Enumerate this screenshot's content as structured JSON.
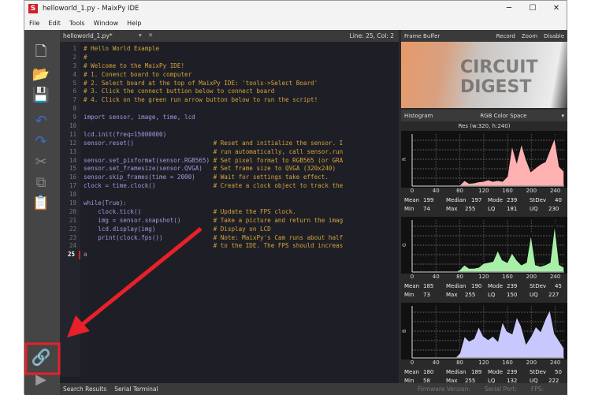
{
  "window": {
    "title": "helloworld_1.py - MaixPy IDE",
    "logo": "S",
    "minimize": "─",
    "maximize": "☐",
    "close": "✕"
  },
  "menu": [
    "File",
    "Edit",
    "Tools",
    "Window",
    "Help"
  ],
  "editor": {
    "tab": "helloworld_1.py*",
    "cursor": "Line: 25, Col: 2",
    "lines": [
      [
        "",
        "# Hello World Example"
      ],
      [
        "",
        "#"
      ],
      [
        "",
        "# Welcome to the MaixPy IDE!"
      ],
      [
        "",
        "# 1. Conenct board to computer"
      ],
      [
        "",
        "# 2. Select board at the top of MaixPy IDE: 'tools->Select Board'"
      ],
      [
        "",
        "# 3. Click the connect buttion below to connect board"
      ],
      [
        "",
        "# 4. Click on the green run arrow button below to run the script!"
      ],
      [
        "",
        ""
      ],
      [
        "import sensor, image, time, lcd",
        ""
      ],
      [
        "",
        ""
      ],
      [
        "lcd.init(freq=15000000)",
        ""
      ],
      [
        "sensor.reset()                      ",
        "# Reset and initialize the sensor. I"
      ],
      [
        "                                    ",
        "# run automatically, call sensor.run"
      ],
      [
        "sensor.set_pixformat(sensor.RGB565) ",
        "# Set pixel format to RGB565 (or GRA"
      ],
      [
        "sensor.set_framesize(sensor.QVGA)   ",
        "# Set frame size to QVGA (320x240)"
      ],
      [
        "sensor.skip_frames(time = 2000)     ",
        "# Wait for settings take effect."
      ],
      [
        "clock = time.clock()                ",
        "# Create a clock object to track the"
      ],
      [
        "",
        ""
      ],
      [
        "while(True):",
        ""
      ],
      [
        "    clock.tick()                    ",
        "# Update the FPS clock."
      ],
      [
        "    img = sensor.snapshot()         ",
        "# Take a picture and return the imag"
      ],
      [
        "    lcd.display(img)                ",
        "# Display on LCD"
      ],
      [
        "    print(clock.fps())              ",
        "# Note: MaixPy's Cam runs about half"
      ],
      [
        "                                    ",
        "# to the IDE. The FPS should increas"
      ],
      [
        "a",
        ""
      ]
    ]
  },
  "frame_buffer": {
    "title": "Frame Buffer",
    "record": "Record",
    "zoom": "Zoom",
    "disable": "Disable",
    "watermark": "CIRCUIT DIGEST"
  },
  "histogram": {
    "title": "Histogram",
    "color_space": "RGB Color Space",
    "res": "Res (w:320, h:240)",
    "ticks": [
      "0",
      "40",
      "80",
      "120",
      "160",
      "200",
      "240"
    ],
    "channels": [
      {
        "label": "R",
        "color": "#ffb0b0",
        "values": [
          0,
          0,
          0,
          0,
          0,
          0,
          0,
          0,
          0,
          0,
          0.02,
          0.12,
          0.06,
          0.07,
          0.09,
          0.1,
          0.13,
          0.1,
          0.12,
          0.1,
          0.2,
          0.85,
          0.5,
          0.88,
          0.55,
          0.3,
          0.38,
          0.45,
          0.5,
          0.75,
          1.0,
          0.4,
          0.3
        ],
        "stats": {
          "Mean": "199",
          "Median": "197",
          "Mode": "239",
          "StDev": "40",
          "Min": "74",
          "Max": "255",
          "LQ": "181",
          "UQ": "230"
        }
      },
      {
        "label": "G",
        "color": "#a8f0a8",
        "values": [
          0,
          0,
          0,
          0,
          0,
          0,
          0,
          0,
          0,
          0,
          0.05,
          0.15,
          0.08,
          0.08,
          0.1,
          0.18,
          0.2,
          0.22,
          0.45,
          0.25,
          0.2,
          0.4,
          0.25,
          0.15,
          0.2,
          0.8,
          0.15,
          0.12,
          0.15,
          0.2,
          1.0,
          0.15,
          0.1
        ],
        "stats": {
          "Mean": "185",
          "Median": "190",
          "Mode": "239",
          "StDev": "45",
          "Min": "73",
          "Max": "255",
          "LQ": "150",
          "UQ": "227"
        }
      },
      {
        "label": "B",
        "color": "#c8c8ff",
        "values": [
          0,
          0,
          0,
          0,
          0,
          0,
          0,
          0,
          0,
          0,
          0.1,
          0.45,
          0.35,
          0.4,
          0.65,
          0.45,
          0.38,
          0.45,
          0.35,
          0.75,
          0.55,
          0.5,
          0.85,
          0.65,
          0.3,
          0.45,
          0.65,
          0.55,
          0.8,
          1.0,
          0.5,
          0.35,
          0.2
        ],
        "stats": {
          "Mean": "180",
          "Median": "189",
          "Mode": "239",
          "StDev": "50",
          "Min": "58",
          "Max": "255",
          "LQ": "132",
          "UQ": "222"
        }
      }
    ]
  },
  "bottom": {
    "search_results": "Search Results",
    "serial_terminal": "Serial Terminal",
    "firmware": "Firmware Version:",
    "serial_port": "Serial Port:",
    "fps": "FPS:"
  }
}
